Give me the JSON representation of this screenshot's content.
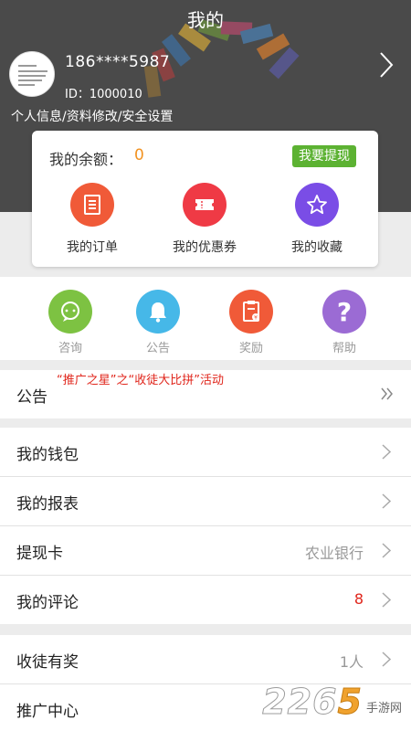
{
  "header": {
    "title": "我的",
    "phone": "186****5987",
    "id_text": "ID：1000010",
    "profile_links": "个人信息/资料修改/安全设置"
  },
  "wallet_card": {
    "balance_label": "我的余额：",
    "balance_value": "0",
    "withdraw_label": "我要提现",
    "items": [
      {
        "label": "我的订单",
        "icon": "order-icon",
        "color": "#f05a38"
      },
      {
        "label": "我的优惠券",
        "icon": "coupon-icon",
        "color": "#ef3a45"
      },
      {
        "label": "我的收藏",
        "icon": "star-icon",
        "color": "#7a4de6"
      }
    ]
  },
  "quick_actions": [
    {
      "label": "咨询",
      "icon": "chat-icon",
      "color": "#7dc242"
    },
    {
      "label": "公告",
      "icon": "bell-icon",
      "color": "#46b8e8"
    },
    {
      "label": "奖励",
      "icon": "reward-icon",
      "color": "#f05a38"
    },
    {
      "label": "帮助",
      "icon": "help-icon",
      "color": "#9b6bd4"
    }
  ],
  "notice": {
    "label": "公告",
    "text": "“推广之星”之“收徒大比拼”活动"
  },
  "menu": [
    {
      "title": "我的钱包",
      "value": ""
    },
    {
      "title": "我的报表",
      "value": ""
    },
    {
      "title": "提现卡",
      "value": "农业银行"
    },
    {
      "title": "我的评论",
      "value": "8",
      "value_color": "#e0251b"
    },
    {
      "title": "收徒有奖",
      "value": "1人"
    },
    {
      "title": "推广中心",
      "value": ""
    }
  ],
  "watermark": {
    "number_a": "22",
    "number_b": "6",
    "number_c": "5",
    "site": "手游网"
  }
}
